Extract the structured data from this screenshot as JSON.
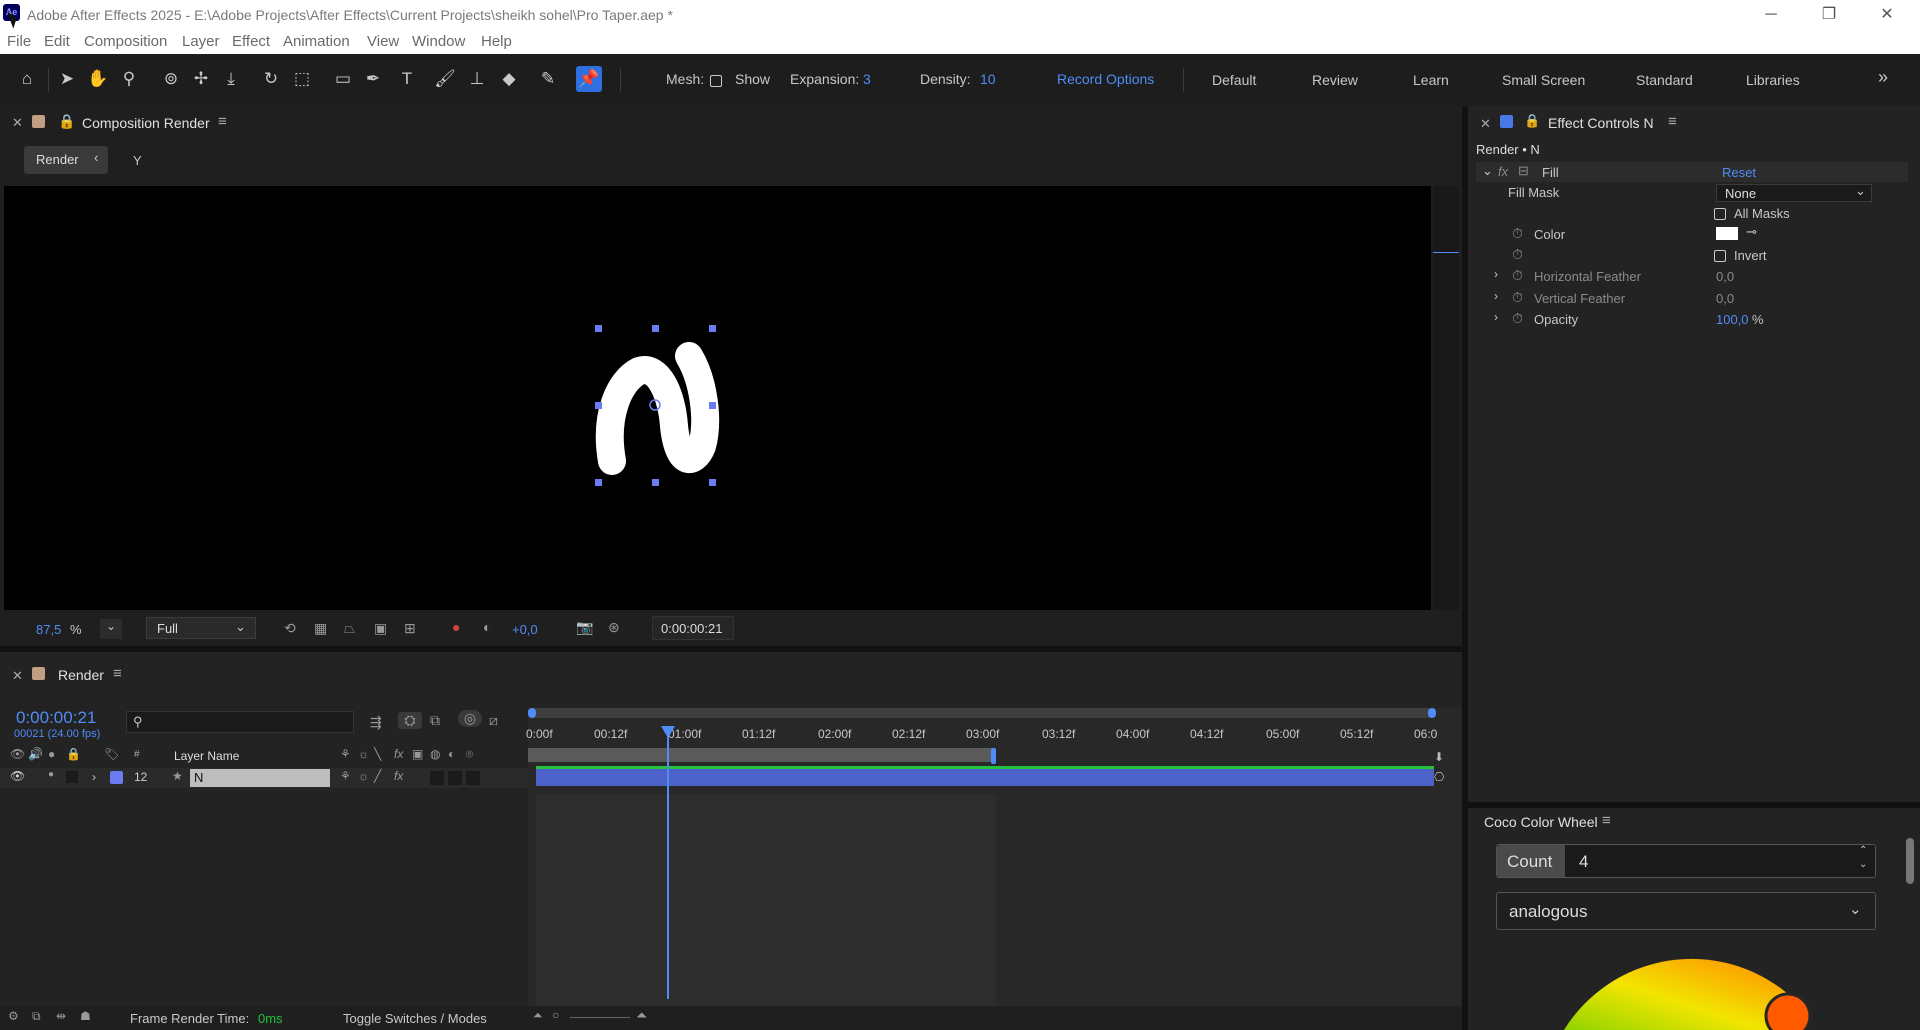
{
  "window": {
    "title": "Adobe After Effects 2025 - E:\\Adobe Projects\\After Effects\\Current Projects\\sheikh sohel\\Pro Taper.aep *",
    "app_icon": "Ae",
    "minimize": "─",
    "maximize": "❐",
    "close": "✕"
  },
  "menu": [
    "File",
    "Edit",
    "Composition",
    "Layer",
    "Effect",
    "Animation",
    "View",
    "Window",
    "Help"
  ],
  "toolbar": {
    "mesh_label": "Mesh:",
    "show_label": "Show",
    "expansion_label": "Expansion:",
    "expansion_value": "3",
    "density_label": "Density:",
    "density_value": "10",
    "record_options": "Record Options",
    "workspaces": [
      "Default",
      "Review",
      "Learn",
      "Small Screen",
      "Standard",
      "Libraries"
    ],
    "more": "»"
  },
  "composition": {
    "panel_title": "Composition Render",
    "breadcrumb_render": "Render",
    "breadcrumb_y": "Y",
    "zoom_value": "87,5",
    "zoom_unit": "%",
    "resolution": "Full",
    "exposure": "+0,0",
    "timecode": "0:00:00:21",
    "letter": "N"
  },
  "effect_controls": {
    "panel_title": "Effect Controls N",
    "layer_path": "Render • N",
    "effect_name": "Fill",
    "reset": "Reset",
    "fill_mask_label": "Fill Mask",
    "fill_mask_value": "None",
    "all_masks": "All Masks",
    "color_label": "Color",
    "invert": "Invert",
    "hfeather_label": "Horizontal Feather",
    "hfeather_value": "0,0",
    "vfeather_label": "Vertical Feather",
    "vfeather_value": "0,0",
    "opacity_label": "Opacity",
    "opacity_value": "100,0",
    "opacity_unit": "%"
  },
  "timeline": {
    "panel_title": "Render",
    "current_time": "0:00:00:21",
    "frame_info": "00021 (24.00 fps)",
    "search_placeholder": "",
    "col_hash": "#",
    "col_layer_name": "Layer Name",
    "layer_number": "12",
    "layer_name": "N",
    "ruler": [
      "0:00f",
      "00:12f",
      "01:00f",
      "01:12f",
      "02:00f",
      "02:12f",
      "03:00f",
      "03:12f",
      "04:00f",
      "04:12f",
      "05:00f",
      "05:12f",
      "06:0"
    ],
    "frame_render_label": "Frame Render Time:",
    "frame_render_value": "0ms",
    "toggle_modes": "Toggle Switches / Modes"
  },
  "color_wheel": {
    "panel_title": "Coco Color Wheel",
    "count_label": "Count",
    "count_value": "4",
    "harmony": "analogous"
  },
  "colors": {
    "accent_blue": "#4f8cf6",
    "layer_bar": "#4d62c9",
    "handle": "#6a7cf0",
    "green_line": "#23c23a"
  }
}
